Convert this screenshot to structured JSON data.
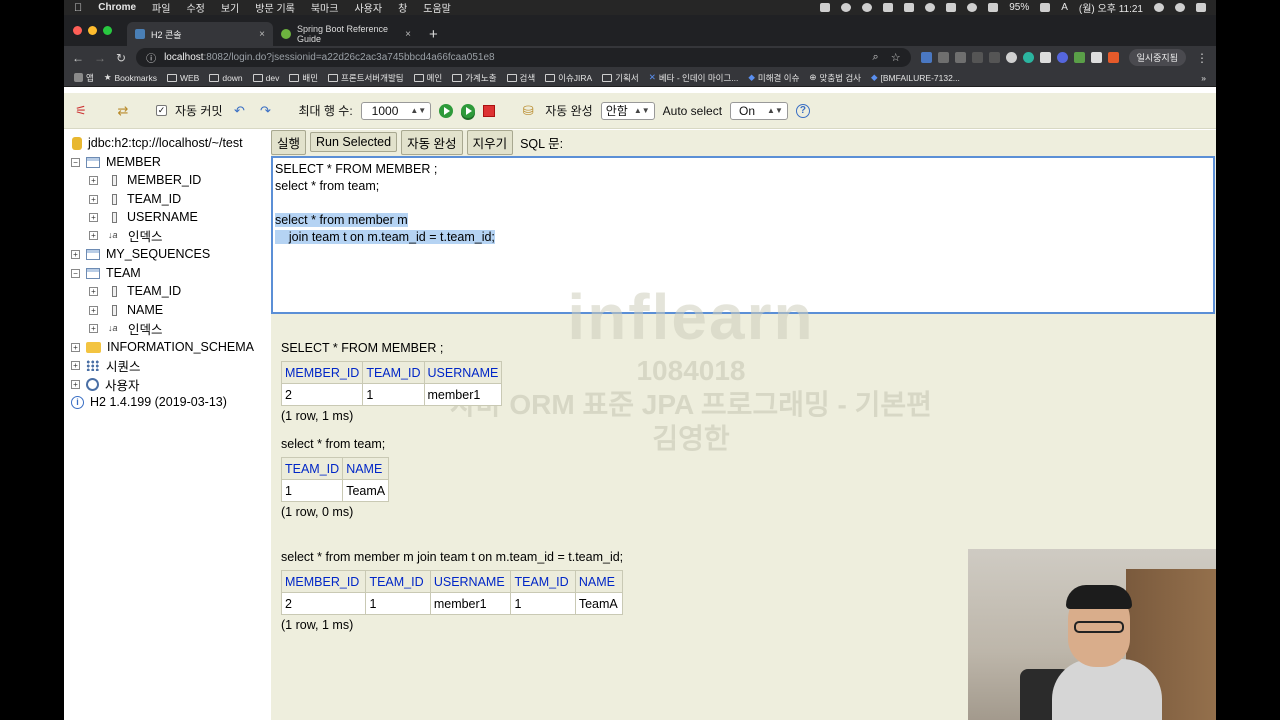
{
  "menubar": {
    "app": "Chrome",
    "menus": [
      "파일",
      "수정",
      "보기",
      "방문 기록",
      "북마크",
      "사용자",
      "창",
      "도움말"
    ],
    "battery": "95%",
    "input_source": "A",
    "clock": "(월) 오후 11:21"
  },
  "browser": {
    "tabs": [
      {
        "title": "H2 콘솔",
        "active": true
      },
      {
        "title": "Spring Boot Reference Guide",
        "active": false
      }
    ],
    "url_host": "localhost",
    "url_path": ":8082/login.do?jsessionid=a22d26c2ac3a745bbcd4a66fcaa051e8",
    "profile": "일시중지됨",
    "bookmarks": [
      "앱",
      "Bookmarks",
      "WEB",
      "down",
      "dev",
      "배민",
      "프론트서버개발팀",
      "메인",
      "가계노출",
      "검색",
      "이슈JIRA",
      "기획서",
      "베타 - 인데이 마이그...",
      "미해결 이슈",
      "맞춤법 검사",
      "[BMFAILURE-7132..."
    ]
  },
  "h2": {
    "toolbar": {
      "auto_commit_label": "자동 커밋",
      "max_rows_label": "최대 행 수:",
      "max_rows_value": "1000",
      "auto_complete_label": "자동 완성",
      "auto_complete_value": "안함",
      "auto_select_label": "Auto select",
      "auto_select_value": "On"
    },
    "tree": {
      "connection": "jdbc:h2:tcp://localhost/~/test",
      "member": "MEMBER",
      "member_cols": [
        "MEMBER_ID",
        "TEAM_ID",
        "USERNAME"
      ],
      "index_label": "인덱스",
      "my_sequences": "MY_SEQUENCES",
      "team": "TEAM",
      "team_cols": [
        "TEAM_ID",
        "NAME"
      ],
      "info_schema": "INFORMATION_SCHEMA",
      "sequences": "시퀀스",
      "users": "사용자",
      "version": "H2 1.4.199 (2019-03-13)"
    },
    "sql_bar": {
      "run": "실행",
      "run_selected": "Run Selected",
      "auto_complete": "자동 완성",
      "clear": "지우기",
      "label": "SQL 문:"
    },
    "editor": {
      "lines": [
        "SELECT * FROM MEMBER ;",
        "select * from team;",
        "",
        "select * from member m",
        "    join team t on m.team_id = t.team_id;"
      ]
    },
    "results": [
      {
        "statement": "SELECT * FROM MEMBER ;",
        "columns": [
          "MEMBER_ID",
          "TEAM_ID",
          "USERNAME"
        ],
        "rows": [
          [
            "2",
            "1",
            "member1"
          ]
        ],
        "count": "(1 row, 1 ms)"
      },
      {
        "statement": "select * from team;",
        "columns": [
          "TEAM_ID",
          "NAME"
        ],
        "rows": [
          [
            "1",
            "TeamA"
          ]
        ],
        "count": "(1 row, 0 ms)"
      },
      {
        "statement": "select * from member m join team t on m.team_id = t.team_id;",
        "columns": [
          "MEMBER_ID",
          "TEAM_ID",
          "USERNAME",
          "TEAM_ID",
          "NAME"
        ],
        "rows": [
          [
            "2",
            "1",
            "member1",
            "1",
            "TeamA"
          ]
        ],
        "count": "(1 row, 1 ms)"
      }
    ]
  },
  "watermark": {
    "logo": "inflearn",
    "id": "1084018",
    "course": "자바 ORM 표준 JPA 프로그래밍 - 기본편",
    "author": "김영한"
  },
  "colors": {
    "h2_bg": "#eeeedd",
    "header_text": "#0026c7",
    "selection": "#b5d3f3",
    "editor_border": "#5b8fd6"
  }
}
